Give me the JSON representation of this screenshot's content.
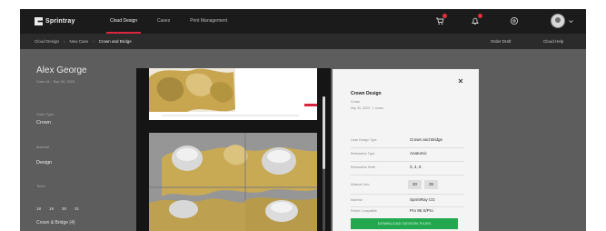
{
  "app": {
    "logo_text": "Sprintray"
  },
  "nav": {
    "items": [
      "Cloud Design",
      "Cases",
      "Print Management"
    ],
    "active": 0
  },
  "breadcrumb": {
    "items": [
      "Cloud Design",
      "New Case",
      "Crown and Bridge"
    ],
    "right_1": "Order Draft",
    "right_2": "Cloud Help"
  },
  "patient": {
    "name": "Alex George",
    "subtitle": "Case #1 · Sep 30, 2023",
    "labels": [
      "Case Type",
      "Material",
      "Teeth"
    ],
    "values": [
      "Crown",
      "Design",
      ""
    ],
    "teeth": [
      "18",
      "19",
      "30",
      "31"
    ],
    "bottom_text": "Crown & Bridge (4)"
  },
  "details": {
    "title": "Crown Design",
    "sub_1": "Crown",
    "sub_2": "Sep 30, 2023 · 1 crown",
    "rows": [
      {
        "key": "Case Design Type",
        "value": "Crown and Bridge"
      },
      {
        "key": "Restoration Type",
        "value": "Anatomic"
      },
      {
        "key": "Restoration Teeth",
        "value": "3, 4, 5"
      }
    ],
    "thickness": {
      "key": "Minimal Cem.",
      "values": [
        "30",
        "35"
      ]
    },
    "rows2": [
      {
        "key": "Material",
        "value": "SprintRay CG"
      },
      {
        "key": "Printer Compatible",
        "value": "Pro 95 S/Pro"
      }
    ],
    "primary_button": "DOWNLOAD DESIGN FILES"
  },
  "colors": {
    "accent": "#d7263d",
    "primary_button": "#23a84f",
    "badge": "#e0303a",
    "topbar": "#1b1b1b",
    "background": "#5d5d5d"
  },
  "icons": [
    "cart-icon",
    "notification-bell-icon",
    "help-icon",
    "avatar-icon",
    "close-icon"
  ]
}
